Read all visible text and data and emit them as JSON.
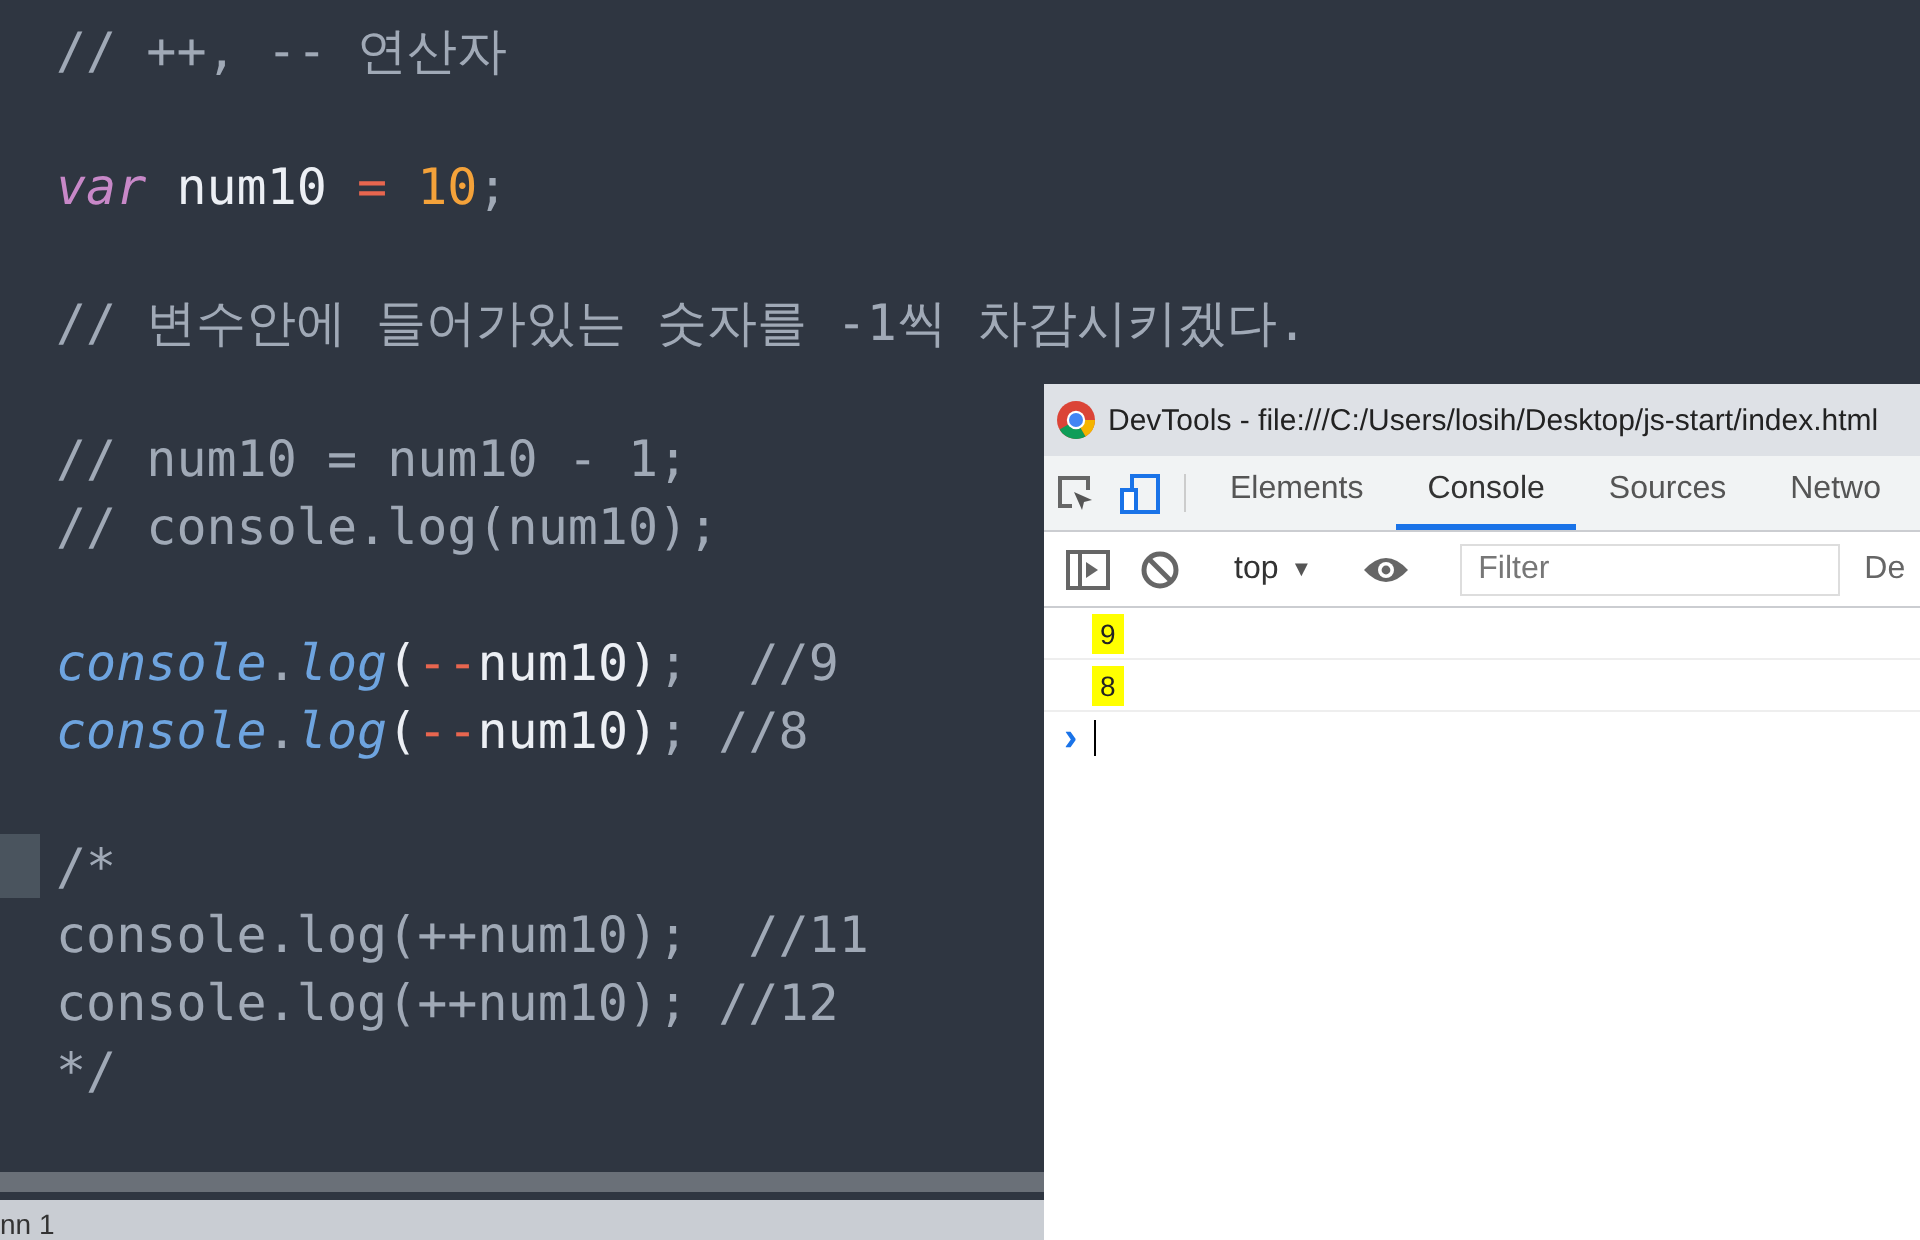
{
  "editor": {
    "lines": [
      {
        "kind": "code",
        "current": false,
        "tokens": [
          {
            "kind": "comment",
            "text": "// ++, -- 연산자"
          }
        ]
      },
      {
        "kind": "blank",
        "current": false
      },
      {
        "kind": "code",
        "current": false,
        "tokens": [
          {
            "kind": "keyword",
            "text": "var"
          },
          {
            "kind": "plain",
            "text": " num10"
          },
          {
            "kind": "operator",
            "text": " = "
          },
          {
            "kind": "number",
            "text": "10"
          },
          {
            "kind": "punct",
            "text": ";"
          }
        ]
      },
      {
        "kind": "blank",
        "current": false
      },
      {
        "kind": "code",
        "current": false,
        "tokens": [
          {
            "kind": "comment",
            "text": "// 변수안에 들어가있는 숫자를 -1씩 차감시키겠다."
          }
        ]
      },
      {
        "kind": "blank",
        "current": false
      },
      {
        "kind": "code",
        "current": false,
        "tokens": [
          {
            "kind": "comment",
            "text": "// num10 = num10 - 1;"
          }
        ]
      },
      {
        "kind": "code",
        "current": false,
        "tokens": [
          {
            "kind": "comment",
            "text": "// console.log(num10);"
          }
        ]
      },
      {
        "kind": "blank",
        "current": false
      },
      {
        "kind": "code",
        "current": false,
        "tokens": [
          {
            "kind": "method",
            "text": "console"
          },
          {
            "kind": "punct",
            "text": "."
          },
          {
            "kind": "method",
            "text": "log"
          },
          {
            "kind": "plain",
            "text": "("
          },
          {
            "kind": "operator",
            "text": "--"
          },
          {
            "kind": "plain",
            "text": "num10)"
          },
          {
            "kind": "punct",
            "text": ";"
          },
          {
            "kind": "comment",
            "text": "  //9"
          }
        ]
      },
      {
        "kind": "code",
        "current": false,
        "tokens": [
          {
            "kind": "method",
            "text": "console"
          },
          {
            "kind": "punct",
            "text": "."
          },
          {
            "kind": "method",
            "text": "log"
          },
          {
            "kind": "plain",
            "text": "("
          },
          {
            "kind": "operator",
            "text": "--"
          },
          {
            "kind": "plain",
            "text": "num10)"
          },
          {
            "kind": "punct",
            "text": ";"
          },
          {
            "kind": "comment",
            "text": " //8"
          }
        ]
      },
      {
        "kind": "blank",
        "current": false
      },
      {
        "kind": "code",
        "current": true,
        "tokens": [
          {
            "kind": "comment",
            "text": "/*"
          }
        ]
      },
      {
        "kind": "code",
        "current": false,
        "tokens": [
          {
            "kind": "comment",
            "text": "console.log(++num10);  //11"
          }
        ]
      },
      {
        "kind": "code",
        "current": false,
        "tokens": [
          {
            "kind": "comment",
            "text": "console.log(++num10); //12"
          }
        ]
      },
      {
        "kind": "code",
        "current": false,
        "tokens": [
          {
            "kind": "comment",
            "text": "*/"
          }
        ]
      }
    ]
  },
  "status_bar": {
    "text": "nn 1"
  },
  "devtools": {
    "title": "DevTools - file:///C:/Users/losih/Desktop/js-start/index.html",
    "tabs": [
      {
        "label": "Elements",
        "selected": false
      },
      {
        "label": "Console",
        "selected": true
      },
      {
        "label": "Sources",
        "selected": false
      },
      {
        "label": "Netwo",
        "selected": false
      }
    ],
    "context": {
      "value": "top",
      "arrow": "▼"
    },
    "filter": {
      "placeholder": "Filter"
    },
    "levels": "De",
    "messages": [
      {
        "text": "9",
        "highlighted": true
      },
      {
        "text": "8",
        "highlighted": true
      }
    ],
    "prompt": "›"
  }
}
